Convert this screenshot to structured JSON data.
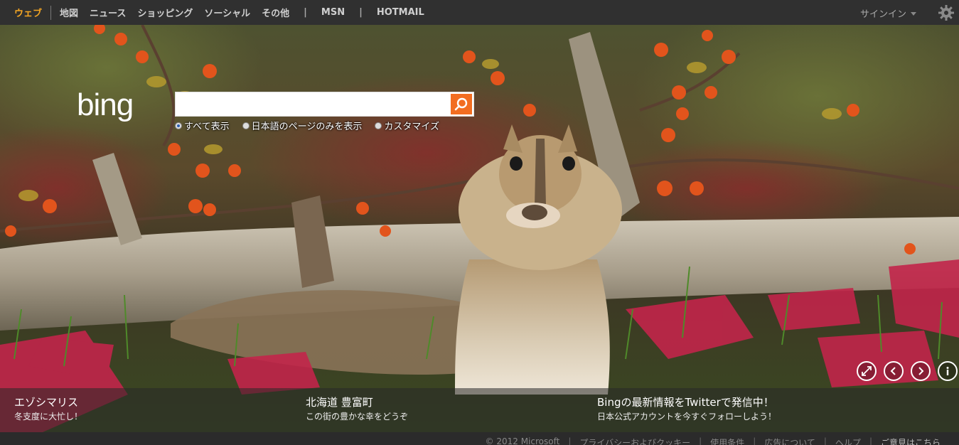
{
  "nav": {
    "items": [
      {
        "label": "ウェブ",
        "active": true
      },
      {
        "label": "地図"
      },
      {
        "label": "ニュース"
      },
      {
        "label": "ショッピング"
      },
      {
        "label": "ソーシャル"
      },
      {
        "label": "その他"
      }
    ],
    "msn": "MSN",
    "hotmail": "HOTMAIL",
    "pipe": "|"
  },
  "account": {
    "signin": "サインイン"
  },
  "search": {
    "value": "",
    "scopes": [
      {
        "label": "すべて表示",
        "selected": true
      },
      {
        "label": "日本語のページのみを表示",
        "selected": false
      },
      {
        "label": "カスタマイズ",
        "selected": false
      }
    ]
  },
  "info": [
    {
      "title": "エゾシマリス",
      "sub": "冬支度に大忙し！"
    },
    {
      "title": "北海道 豊富町",
      "sub": "この街の豊かな幸をどうぞ"
    },
    {
      "title": "Bingの最新情報をTwitterで発信中！",
      "sub": "日本公式アカウントを今すぐフォローしよう！"
    }
  ],
  "controls": [
    "expand-icon",
    "prev-icon",
    "next-icon",
    "info-icon"
  ],
  "footer": {
    "copyright": "© 2012 Microsoft",
    "links": [
      "プライバシーおよびクッキー",
      "使用条件",
      "広告について",
      "ヘルプ"
    ],
    "feedback": "ご意見はこちら"
  },
  "colors": {
    "accent": "#f5a623",
    "search_button": "#f26d21",
    "topbar": "#303030"
  }
}
